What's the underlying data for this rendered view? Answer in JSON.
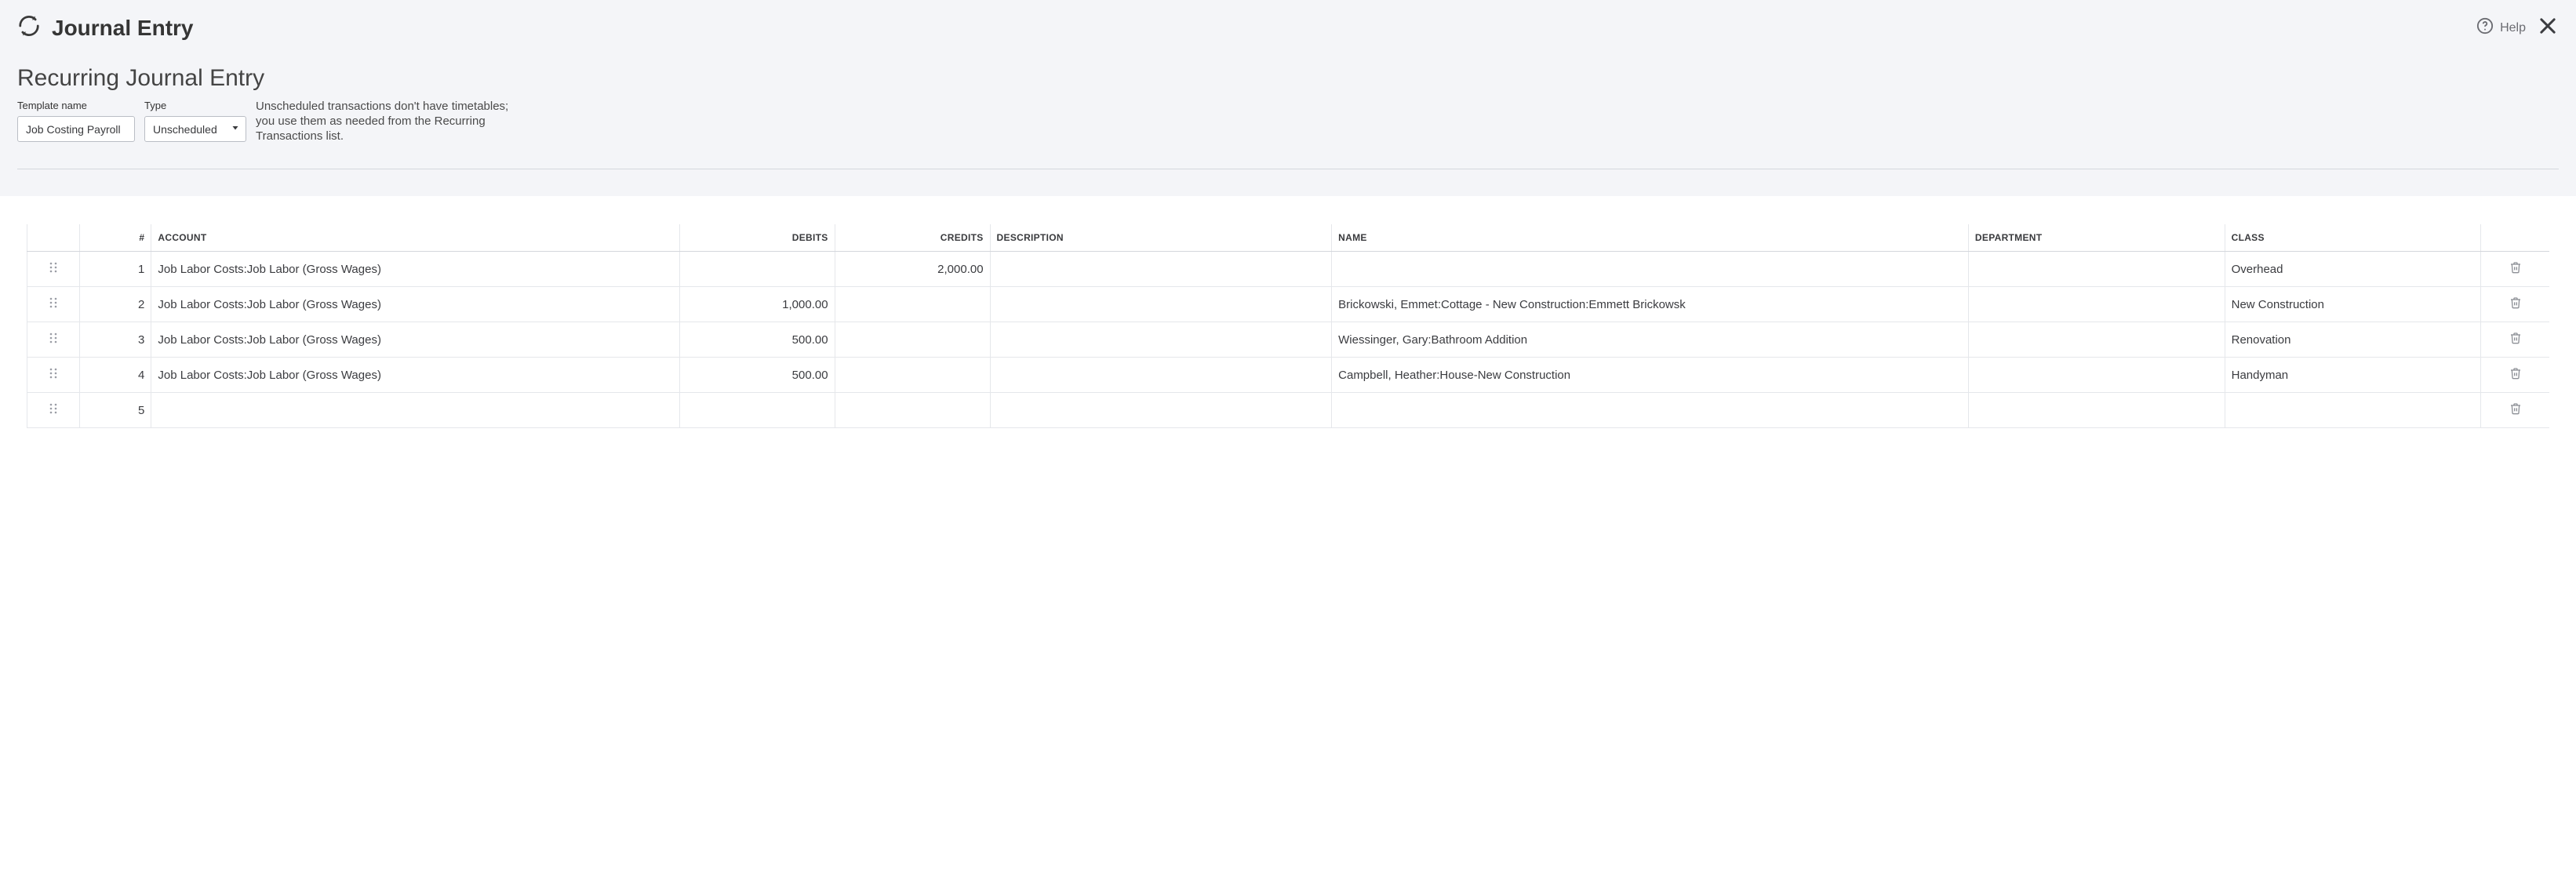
{
  "header": {
    "title": "Journal Entry",
    "help_label": "Help"
  },
  "section": {
    "title": "Recurring Journal Entry",
    "template_label": "Template name",
    "template_value": "Job Costing Payroll",
    "type_label": "Type",
    "type_value": "Unscheduled",
    "hint": "Unscheduled transactions don't have timetables; you use them as needed from the Recurring Transactions list."
  },
  "table": {
    "headers": {
      "num": "#",
      "account": "ACCOUNT",
      "debits": "DEBITS",
      "credits": "CREDITS",
      "description": "DESCRIPTION",
      "name": "NAME",
      "department": "DEPARTMENT",
      "class": "CLASS"
    },
    "rows": [
      {
        "num": "1",
        "account": "Job Labor Costs:Job Labor (Gross Wages)",
        "debits": "",
        "credits": "2,000.00",
        "description": "",
        "name": "",
        "department": "",
        "class": "Overhead"
      },
      {
        "num": "2",
        "account": "Job Labor Costs:Job Labor (Gross Wages)",
        "debits": "1,000.00",
        "credits": "",
        "description": "",
        "name": "Brickowski, Emmet:Cottage - New Construction:Emmett Brickowsk",
        "department": "",
        "class": "New Construction"
      },
      {
        "num": "3",
        "account": "Job Labor Costs:Job Labor (Gross Wages)",
        "debits": "500.00",
        "credits": "",
        "description": "",
        "name": "Wiessinger, Gary:Bathroom Addition",
        "department": "",
        "class": "Renovation"
      },
      {
        "num": "4",
        "account": "Job Labor Costs:Job Labor (Gross Wages)",
        "debits": "500.00",
        "credits": "",
        "description": "",
        "name": "Campbell, Heather:House-New Construction",
        "department": "",
        "class": "Handyman"
      },
      {
        "num": "5",
        "account": "",
        "debits": "",
        "credits": "",
        "description": "",
        "name": "",
        "department": "",
        "class": ""
      }
    ]
  }
}
